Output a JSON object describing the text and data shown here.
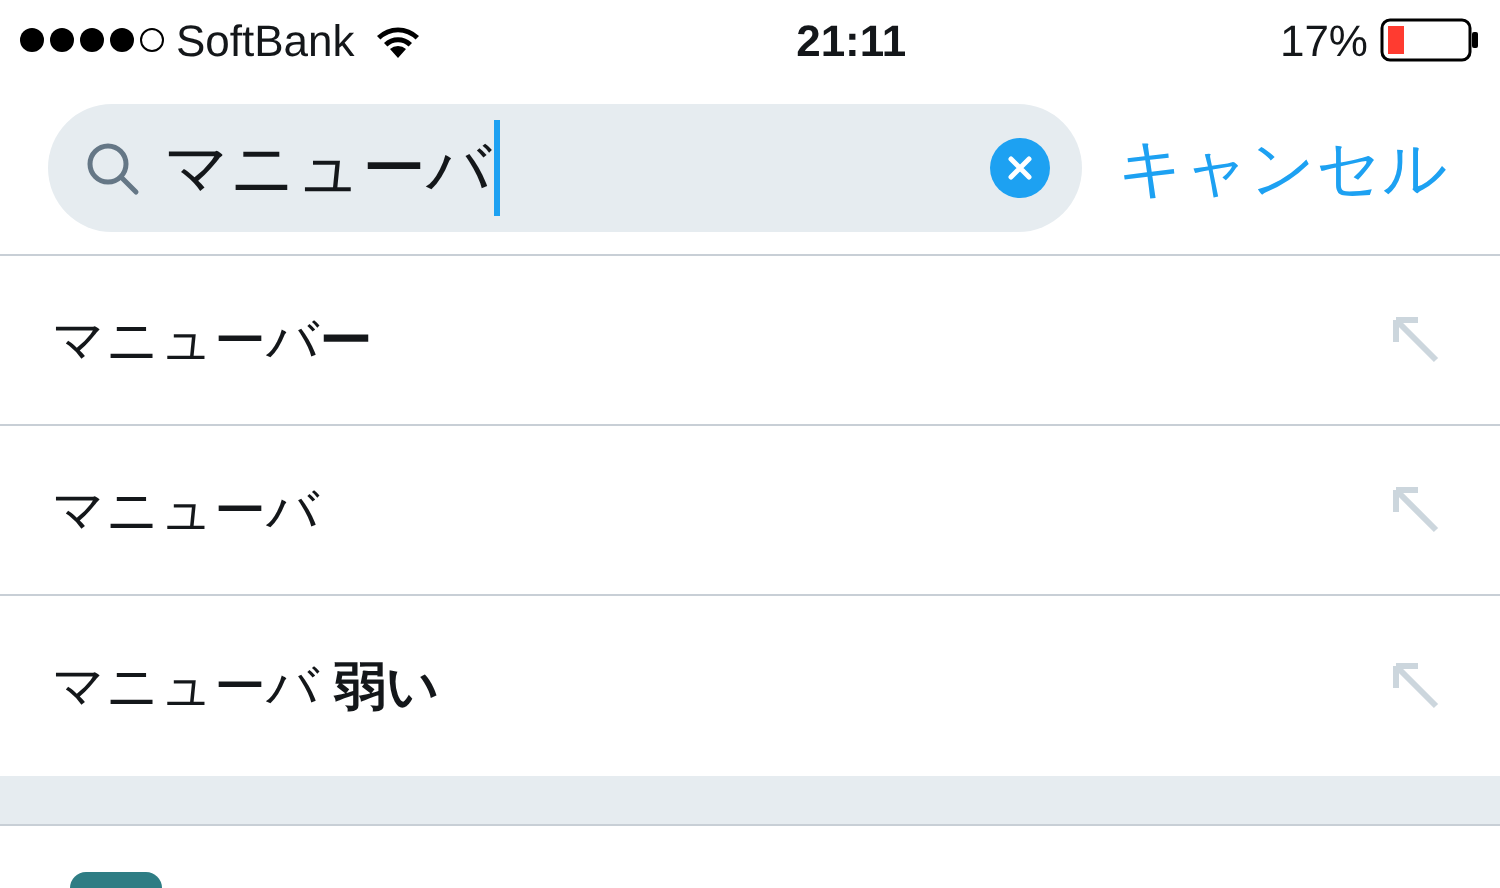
{
  "status_bar": {
    "carrier": "SoftBank",
    "time": "21:11",
    "battery": "17%"
  },
  "search": {
    "value": "マニューバ",
    "cancel": "キャンセル"
  },
  "suggestions": [
    {
      "text": "マニューバ**ー**"
    },
    {
      "text": "マニューバ"
    },
    {
      "text": "マニューバ **弱い**"
    }
  ]
}
